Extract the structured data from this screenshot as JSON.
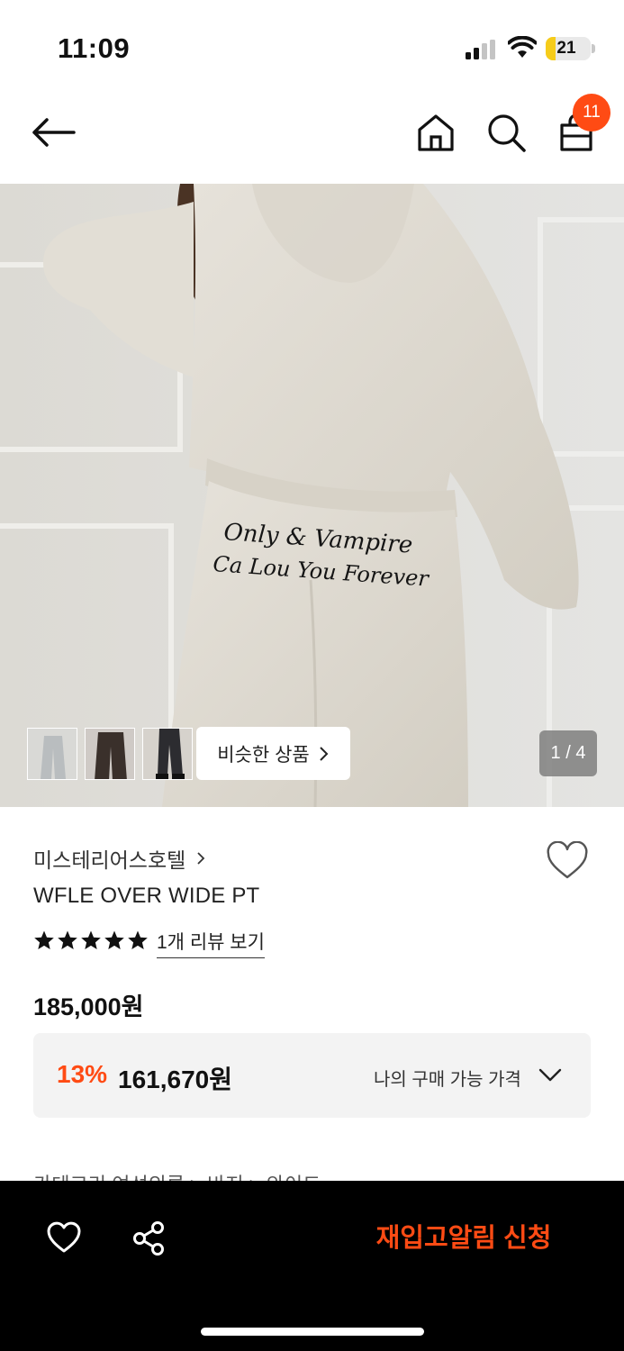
{
  "status_bar": {
    "time": "11:09",
    "battery": "21",
    "battery_level": 0.21
  },
  "header": {
    "icons": [
      "back-arrow-icon",
      "home-icon",
      "search-icon",
      "shopping-bag-icon"
    ],
    "cart_count": "11"
  },
  "gallery": {
    "similar_label": "비슷한 상품",
    "page_indicator": "1 / 4",
    "artwork_text": [
      "Only & Vampire",
      "Ca Lou You Forever"
    ]
  },
  "product": {
    "brand": "미스테리어스호텔",
    "name": "WFLE OVER WIDE PT",
    "rating": 5,
    "review_link": "1개 리뷰 보기",
    "price": "185,000원",
    "discount": "13%",
    "sale_price": "161,670원",
    "my_price_label": "나의 구매 가능 가격",
    "category_partial": "카테고리        여성의류 > 바지 > 와이드"
  },
  "bottom_bar": {
    "restock_label": "재입고알림 신청"
  },
  "colors": {
    "accent": "#ff4b14",
    "bar": "#000000"
  }
}
